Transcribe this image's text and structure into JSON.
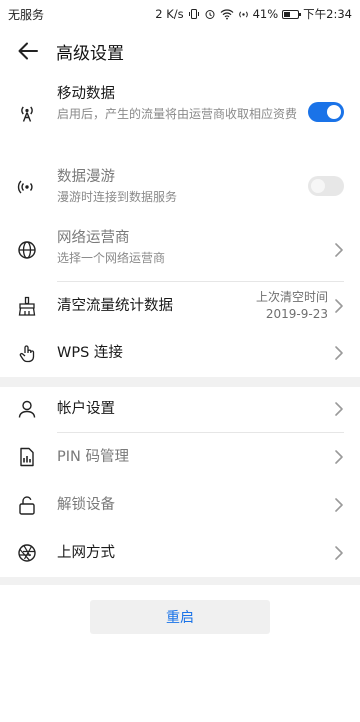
{
  "status_bar": {
    "carrier": "无服务",
    "speed": "2 K/s",
    "battery_percent_label": "41%",
    "battery_level": 0.41,
    "time": "下午2:34"
  },
  "header": {
    "title": "高级设置"
  },
  "settings": {
    "mobile_data": {
      "label": "移动数据",
      "desc": "启用后，产生的流量将由运营商收取相应资费",
      "toggle_on": true
    },
    "data_roaming": {
      "label": "数据漫游",
      "desc": "漫游时连接到数据服务",
      "toggle_on": false
    },
    "network_operator": {
      "label": "网络运营商",
      "desc": "选择一个网络运营商"
    },
    "clear_traffic": {
      "label": "清空流量统计数据",
      "value_line1": "上次清空时间",
      "value_line2": "2019-9-23"
    },
    "wps": {
      "label": "WPS 连接"
    },
    "account": {
      "label": "帐户设置"
    },
    "pin": {
      "label": "PIN 码管理"
    },
    "unlock": {
      "label": "解锁设备"
    },
    "internet_mode": {
      "label": "上网方式"
    }
  },
  "actions": {
    "restart_label": "重启"
  },
  "colors": {
    "accent": "#1a73e8",
    "section_gap": "#f1f1f1"
  }
}
